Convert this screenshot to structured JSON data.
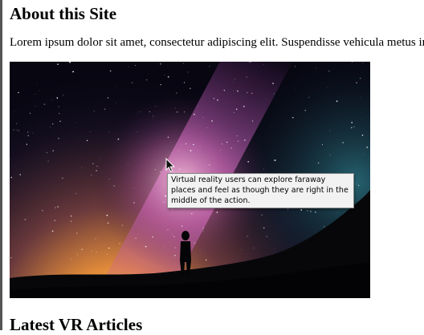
{
  "page": {
    "heading": "About this Site",
    "intro_text": "Lorem ipsum dolor sit amet, consectetur adipiscing elit. Suspendisse vehicula metus in bi",
    "image_tooltip": "Virtual reality users can explore faraway places and feel as though they are right in the middle of the action.",
    "next_heading": "Latest VR Articles"
  },
  "icons": {
    "cursor": "arrow-cursor-icon"
  }
}
